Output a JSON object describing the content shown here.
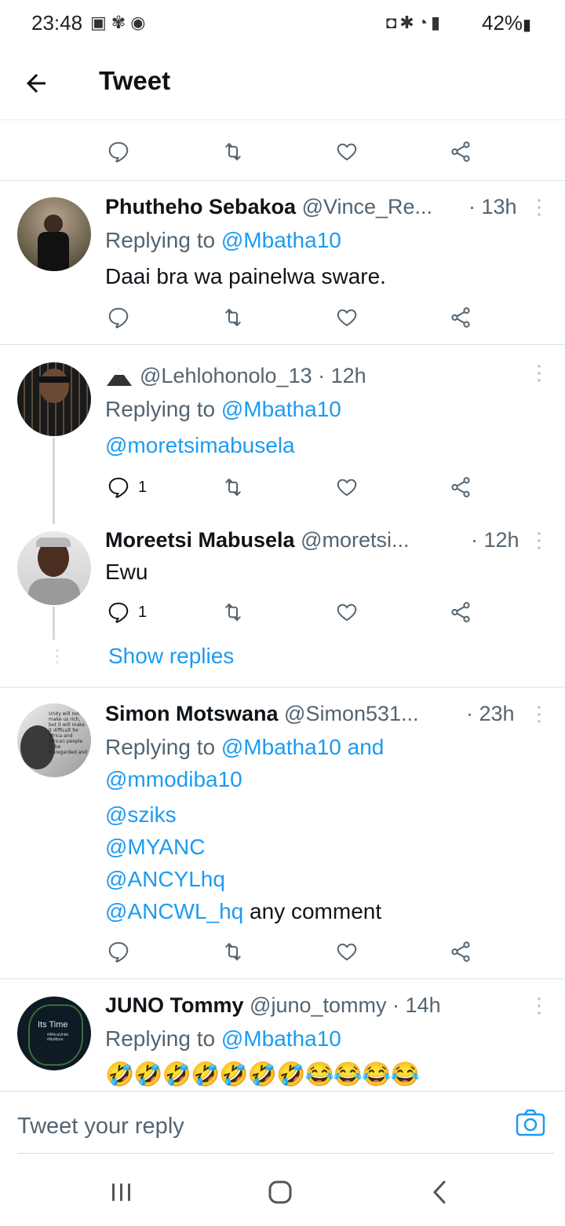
{
  "status_bar": {
    "time": "23:48",
    "battery": "42%",
    "left_icons": [
      "image-icon",
      "pinwheel-icon",
      "chrome-icon"
    ],
    "right_icons": [
      "nfc-icon",
      "bluetooth-icon",
      "wifi-icon",
      "signal-icon",
      "battery-icon"
    ]
  },
  "header": {
    "title": "Tweet"
  },
  "tweets": [
    {
      "name": "Phutheho Sebakoa",
      "handle": "@Vince_Re...",
      "time": "· 13h",
      "reply_prefix": "Replying to",
      "reply_to": "@Mbatha10",
      "body": "Daai bra wa painelwa sware."
    },
    {
      "name": "",
      "handle": "@Lehlohonolo_13",
      "time": "· 12h",
      "reply_prefix": "Replying to",
      "reply_to": "@Mbatha10",
      "body_mention": "@moretsimabusela",
      "reply_count": "1"
    },
    {
      "name": "Moreetsi Mabusela",
      "handle": "@moretsi...",
      "time": "· 12h",
      "body": "Ewu",
      "reply_count": "1",
      "show_replies": "Show replies"
    },
    {
      "name": "Simon Motswana",
      "handle": "@Simon531...",
      "time": "· 23h",
      "reply_prefix": "Replying to",
      "reply_to": "@Mbatha10 and",
      "reply_to_2": "@mmodiba10",
      "lines": [
        "@sziks",
        "@MYANC",
        "@ANCYLhq"
      ],
      "last_mention": "@ANCWL_hq",
      "last_text": " any comment"
    },
    {
      "name": "JUNO Tommy",
      "handle": "@juno_tommy",
      "time": "· 14h",
      "reply_prefix": "Replying to",
      "reply_to": "@Mbatha10",
      "body": "🤣🤣🤣🤣🤣🤣🤣😂😂😂😂"
    }
  ],
  "avatar_text": {
    "simon": "Unity will not make us rich, but it will make it difficult for Africa and African people to be disregarded and humiliated",
    "juno": "Its Time",
    "juno_sub": "#AfricaUnite #NoMore"
  },
  "composer": {
    "placeholder": "Tweet your reply"
  },
  "colors": {
    "link": "#1d9bf0",
    "secondary": "#536471"
  }
}
